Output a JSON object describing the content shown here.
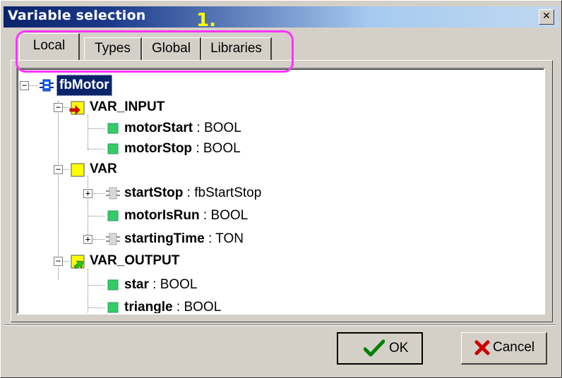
{
  "window": {
    "title": "Variable selection",
    "close_glyph": "✕"
  },
  "annotation": {
    "number": "1.",
    "ring_color": "#ff33ff",
    "number_color": "#ffff00"
  },
  "tabs": [
    {
      "label": "Local",
      "selected": true
    },
    {
      "label": "Types",
      "selected": false
    },
    {
      "label": "Global",
      "selected": false
    },
    {
      "label": "Libraries",
      "selected": false
    }
  ],
  "tree": {
    "root": {
      "name": "fbMotor",
      "icon": "function-block-icon"
    },
    "groups": [
      {
        "label": "VAR_INPUT",
        "icon": "input-folder-icon",
        "items": [
          {
            "name": "motorStart",
            "type": " : BOOL",
            "icon": "variable-icon"
          },
          {
            "name": "motorStop",
            "type": " : BOOL",
            "icon": "variable-icon"
          }
        ]
      },
      {
        "label": "VAR",
        "icon": "local-folder-icon",
        "items": [
          {
            "name": "startStop",
            "type": " : fbStartStop",
            "icon": "instance-icon",
            "expandable": true
          },
          {
            "name": "motorIsRun",
            "type": " : BOOL",
            "icon": "variable-icon"
          },
          {
            "name": "startingTime",
            "type": " : TON",
            "icon": "instance-icon",
            "expandable": true
          }
        ]
      },
      {
        "label": "VAR_OUTPUT",
        "icon": "output-folder-icon",
        "items": [
          {
            "name": "star",
            "type": " : BOOL",
            "icon": "variable-icon"
          },
          {
            "name": "triangle",
            "type": " : BOOL",
            "icon": "variable-icon"
          }
        ]
      }
    ]
  },
  "buttons": {
    "ok": {
      "label": "OK",
      "icon": "checkmark-icon"
    },
    "cancel": {
      "label": "Cancel",
      "icon": "x-mark-icon"
    }
  },
  "colors": {
    "title_gradient_start": "#0a246a",
    "title_gradient_end": "#a6caf0",
    "variable_green": "#33cc66",
    "folder_yellow": "#ffff00",
    "input_arrow_red": "#e00000",
    "output_arrow_green": "#22cc22"
  }
}
